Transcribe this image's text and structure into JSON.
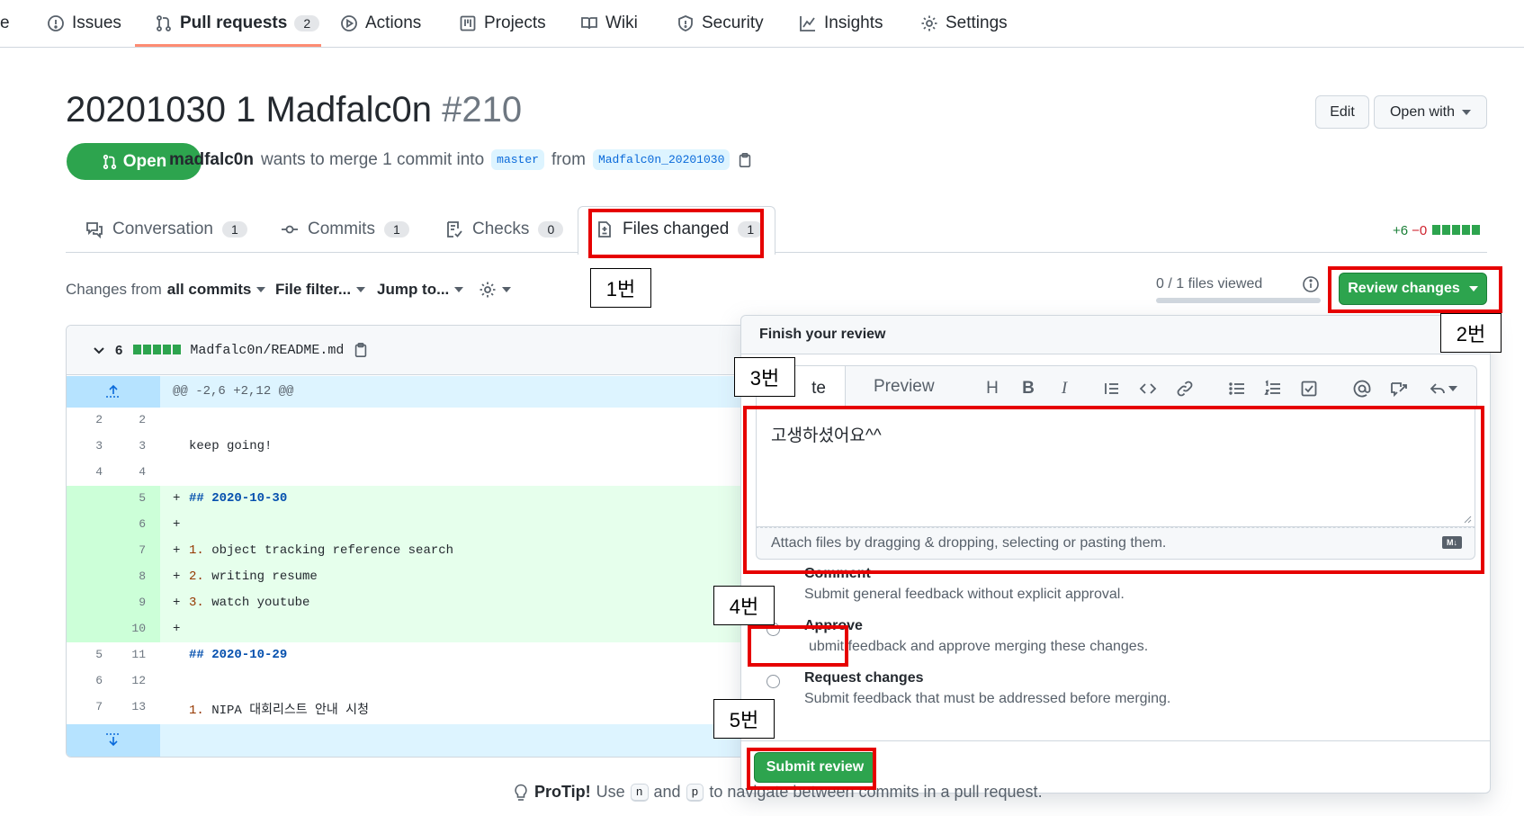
{
  "nav": {
    "cut_label": "e",
    "issues": "Issues",
    "pull_requests": "Pull requests",
    "pull_requests_count": "2",
    "actions": "Actions",
    "projects": "Projects",
    "wiki": "Wiki",
    "security": "Security",
    "insights": "Insights",
    "settings": "Settings"
  },
  "pr": {
    "title": "20201030 1 Madfalc0n",
    "number": "#210",
    "state": "Open",
    "author": "madfalc0n",
    "merge_text": "wants to merge 1 commit into",
    "base_branch": "master",
    "from_text": "from",
    "head_branch": "Madfalc0n_20201030",
    "edit_label": "Edit",
    "open_with_label": "Open with"
  },
  "tabs": {
    "conversation": "Conversation",
    "conversation_count": "1",
    "commits": "Commits",
    "commits_count": "1",
    "checks": "Checks",
    "checks_count": "0",
    "files_changed": "Files changed",
    "files_changed_count": "1"
  },
  "diffstat": {
    "additions": "+6",
    "deletions": "−0"
  },
  "toolbar": {
    "changes_from_prefix": "Changes from",
    "changes_from_value": "all commits",
    "file_filter": "File filter...",
    "jump_to": "Jump to...",
    "files_viewed": "0 / 1 files viewed",
    "files_viewed_progress": 0,
    "review_changes": "Review changes"
  },
  "file": {
    "lines_changed": "6",
    "path": "Madfalc0n/README.md",
    "hunk_header": "@@ -2,6 +2,12 @@",
    "rows": [
      {
        "old": "2",
        "new": "2",
        "sign": "",
        "text": ""
      },
      {
        "old": "3",
        "new": "3",
        "sign": "",
        "text": "keep going!"
      },
      {
        "old": "4",
        "new": "4",
        "sign": "",
        "text": ""
      },
      {
        "old": "",
        "new": "5",
        "sign": "+",
        "text": "## 2020-10-30"
      },
      {
        "old": "",
        "new": "6",
        "sign": "+",
        "text": ""
      },
      {
        "old": "",
        "new": "7",
        "sign": "+",
        "num": "1.",
        "text": " object tracking reference search"
      },
      {
        "old": "",
        "new": "8",
        "sign": "+",
        "num": "2.",
        "text": " writing resume"
      },
      {
        "old": "",
        "new": "9",
        "sign": "+",
        "num": "3.",
        "text": " watch youtube"
      },
      {
        "old": "",
        "new": "10",
        "sign": "+",
        "text": ""
      },
      {
        "old": "5",
        "new": "11",
        "sign": "",
        "text": "## 2020-10-29"
      },
      {
        "old": "6",
        "new": "12",
        "sign": "",
        "text": ""
      },
      {
        "old": "7",
        "new": "13",
        "sign": "",
        "num": "1.",
        "text": " NIPA 대회리스트 안내 시청"
      }
    ]
  },
  "review": {
    "title": "Finish your review",
    "write_tab": "Write",
    "write_tab_visible": "te",
    "preview_tab": "Preview",
    "body": "고생하셨어요^^",
    "attach_hint": "Attach files by dragging & dropping, selecting or pasting them.",
    "options": [
      {
        "label": "Comment",
        "desc": "Submit general feedback without explicit approval."
      },
      {
        "label": "Approve",
        "desc": "Submit feedback and approve merging these changes.",
        "desc_visible": "ubmit feedback and approve merging these changes."
      },
      {
        "label": "Request changes",
        "desc": "Submit feedback that must be addressed before merging."
      }
    ],
    "submit": "Submit review"
  },
  "protip": {
    "label": "ProTip!",
    "text1": "Use",
    "key1": "n",
    "text2": "and",
    "key2": "p",
    "text3": "to navigate between commits in a pull request."
  },
  "annotations": {
    "step1": "1번",
    "step2": "2번",
    "step3": "3번",
    "step4": "4번",
    "step5": "5번",
    "highlight_color": "#e60000"
  },
  "colors": {
    "primary_green": "#2da44e",
    "link_blue": "#0969da",
    "addition_bg": "#e6ffec",
    "hunk_bg": "#ddf4ff"
  }
}
